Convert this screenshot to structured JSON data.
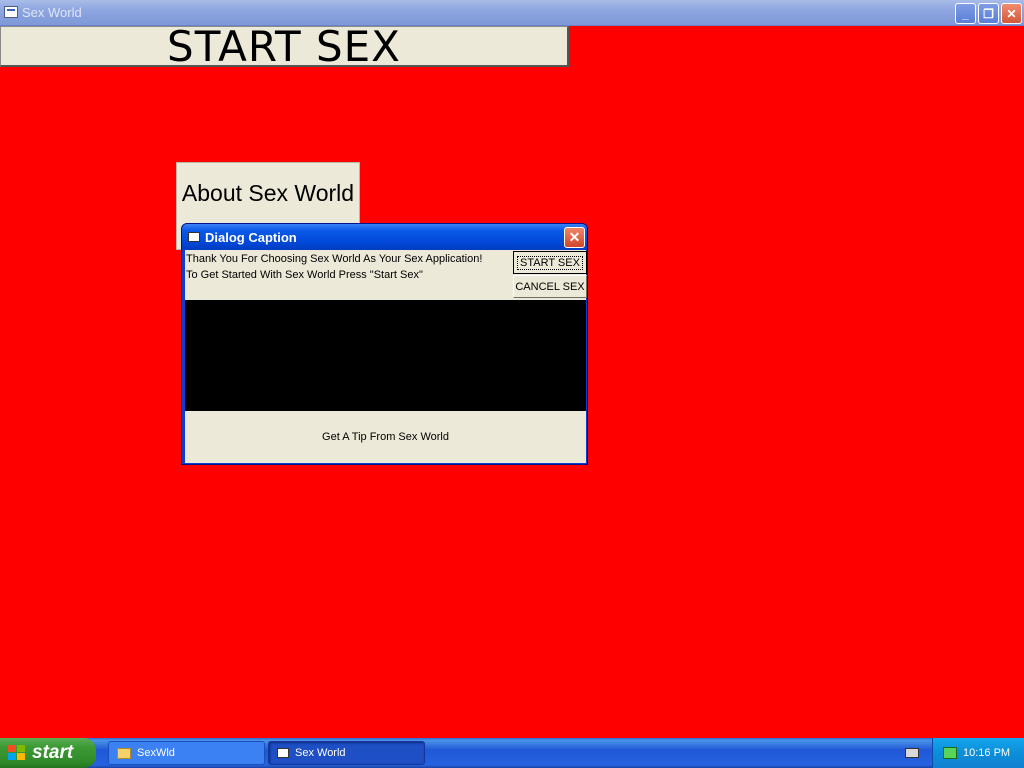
{
  "main_window": {
    "title": "Sex World",
    "controls": {
      "minimize": "_",
      "maximize": "❐",
      "close": "✕"
    }
  },
  "main": {
    "start_button": "START SEX",
    "about_button": "About Sex World"
  },
  "dialog": {
    "title": "Dialog Caption",
    "close": "✕",
    "message_line1": "Thank You For Choosing Sex World As Your Sex Application!",
    "message_line2": "To Get Started With Sex World Press \"Start Sex\"",
    "start_button": "START SEX",
    "cancel_button": "CANCEL SEX",
    "tip_button": "Get A Tip From Sex World"
  },
  "taskbar": {
    "start_label": "start",
    "tasks": [
      {
        "label": "SexWld",
        "icon": "folder-icon"
      },
      {
        "label": "Sex World",
        "icon": "window-icon",
        "active": true
      }
    ],
    "clock": "10:16 PM"
  }
}
